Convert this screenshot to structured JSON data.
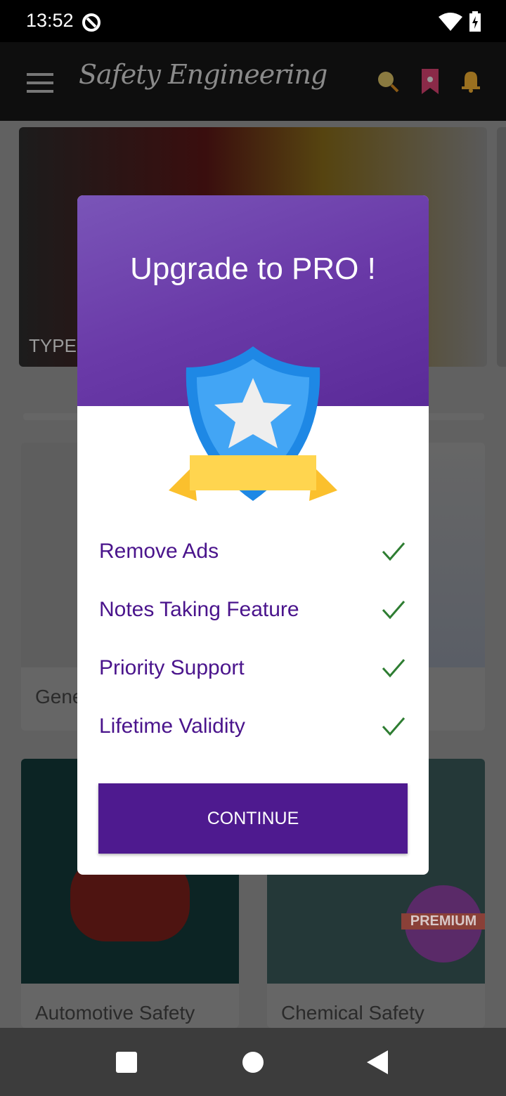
{
  "status_bar": {
    "time": "13:52"
  },
  "app_bar": {
    "title": "Safety Engineering"
  },
  "background": {
    "banner_label": "TYPE",
    "cards": [
      {
        "label": "Gene"
      },
      {
        "label": ""
      },
      {
        "label": "Automotive Safety"
      },
      {
        "label": "Chemical Safety",
        "badge": "PREMIUM"
      }
    ]
  },
  "dialog": {
    "title": "Upgrade to PRO !",
    "features": [
      {
        "label": "Remove Ads"
      },
      {
        "label": "Notes Taking Feature"
      },
      {
        "label": "Priority Support"
      },
      {
        "label": "Lifetime Validity"
      }
    ],
    "continue_label": "CONTINUE",
    "colors": {
      "accent": "#4e1a8f",
      "check": "#2e7d32",
      "header": "#6a3aa8"
    }
  }
}
